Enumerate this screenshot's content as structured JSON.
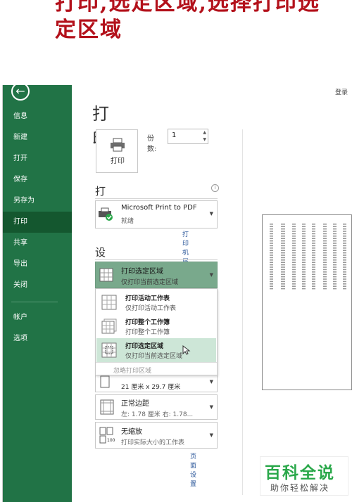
{
  "caption": "打印,选定区域,选择打印选定区域",
  "window": {
    "login": "登录"
  },
  "sidebar": {
    "items": [
      {
        "label": "信息"
      },
      {
        "label": "新建"
      },
      {
        "label": "打开"
      },
      {
        "label": "保存"
      },
      {
        "label": "另存为"
      },
      {
        "label": "打印",
        "active": true
      },
      {
        "label": "共享"
      },
      {
        "label": "导出"
      },
      {
        "label": "关闭"
      },
      {
        "label": "帐户"
      },
      {
        "label": "选项"
      }
    ]
  },
  "print": {
    "title": "打印",
    "button_label": "打印",
    "copies_label": "份数:",
    "copies_value": "1"
  },
  "printer": {
    "heading": "打印机",
    "name": "Microsoft Print to PDF",
    "status": "就绪",
    "properties_link": "打印机属性"
  },
  "settings": {
    "heading": "设置",
    "selected": {
      "main": "打印选定区域",
      "sub": "仅打印当前选定区域"
    },
    "menu": [
      {
        "main": "打印活动工作表",
        "sub": "仅打印活动工作表"
      },
      {
        "main": "打印整个工作簿",
        "sub": "打印整个工作簿"
      },
      {
        "main": "打印选定区域",
        "sub": "仅打印当前选定区域",
        "highlighted": true
      }
    ],
    "menu_footer": "忽略打印区域",
    "paper_size": "21 厘米 x 29.7 厘米",
    "margins": {
      "main": "正常边距",
      "sub": "左: 1.78 厘米    右: 1.78..."
    },
    "scaling": {
      "main": "无缩放",
      "sub": "打印实际大小的工作表"
    },
    "page_setup_link": "页面设置"
  },
  "watermark": {
    "title": "百科全说",
    "subtitle": "助你轻松解决"
  },
  "colors": {
    "sidebar": "#217346",
    "sidebar_active": "#14572f",
    "highlight": "#cde6d7",
    "caption": "#b3111b"
  }
}
